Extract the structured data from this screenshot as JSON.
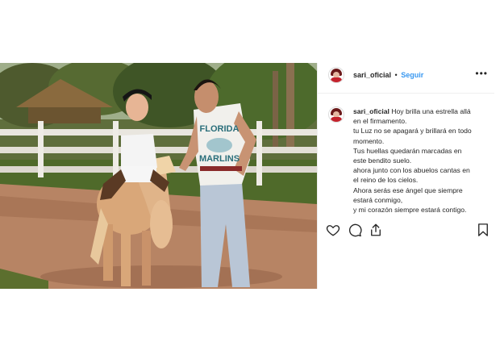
{
  "post": {
    "username": "sari_oficial",
    "separator": "•",
    "follow_label": "Seguir",
    "more_label": "•••",
    "caption": {
      "lines": [
        "Hoy brilla una estrella allá",
        "en el firmamento.",
        "tu Luz no se apagará y brillará en todo",
        "momento.",
        "Tus huellas quedarán marcadas en",
        "este bendito suelo.",
        "ahora junto con los abuelos cantas en",
        "el reino de los cielos.",
        "Ahora serás ese ángel que siempre",
        "estará conmigo,",
        "y mi corazón siempre estará contigo."
      ]
    },
    "shirt_text": {
      "line1": "FLORIDA",
      "line2": "MARLINS"
    },
    "actions": {
      "like": "heart-icon",
      "comment": "comment-icon",
      "share": "share-icon",
      "save": "bookmark-icon"
    }
  }
}
